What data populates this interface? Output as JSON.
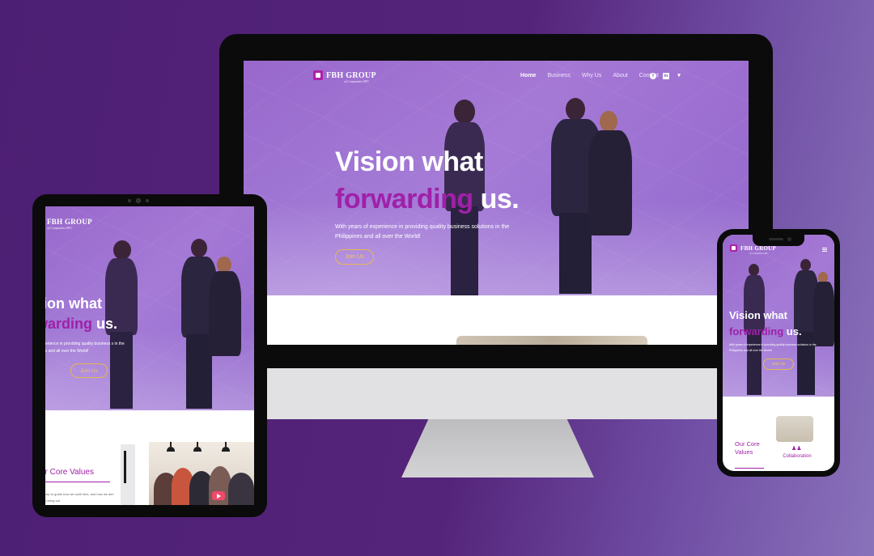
{
  "brand": {
    "name": "FBH GROUP",
    "subtitle": "of Companies OPC",
    "accent_color": "#a020a8",
    "button_color": "#e6b84c"
  },
  "desktop": {
    "nav": {
      "items": [
        "Home",
        "Business",
        "Why Us",
        "About",
        "Contact"
      ],
      "active": "Home",
      "social_icons": [
        "facebook-icon",
        "linkedin-icon",
        "twitter-icon"
      ]
    },
    "hero": {
      "title_line1": "Vision what",
      "title_accent": "forwarding",
      "title_end": " us.",
      "description": "With years of experience in providing quality business solutions in the Philippines and all over the World!",
      "cta": "Join Us"
    }
  },
  "tablet": {
    "logo_name": "FBH GROUP",
    "logo_sub": "of Companies OPC",
    "title_line1": "ision what",
    "title_accent": "rwarding",
    "title_end": " us.",
    "description": "ars of experience in providing quality business s in the Philippines and all over the World!",
    "cta": "Join Us",
    "section_title": "ur Core Values",
    "section_text": "help to guide how we work ities, and how we aim to bring out"
  },
  "phone": {
    "logo_name": "FBH GROUP",
    "logo_sub": "of Companies OPC",
    "title_line1": "Vision what",
    "title_accent": "forwarding",
    "title_end": " us.",
    "description": "With years of experience in providing quality business solutions in the Philippines and all over the World!",
    "cta": "Join Us",
    "core_values": "Our Core Values",
    "card_label": "Collaboration"
  }
}
